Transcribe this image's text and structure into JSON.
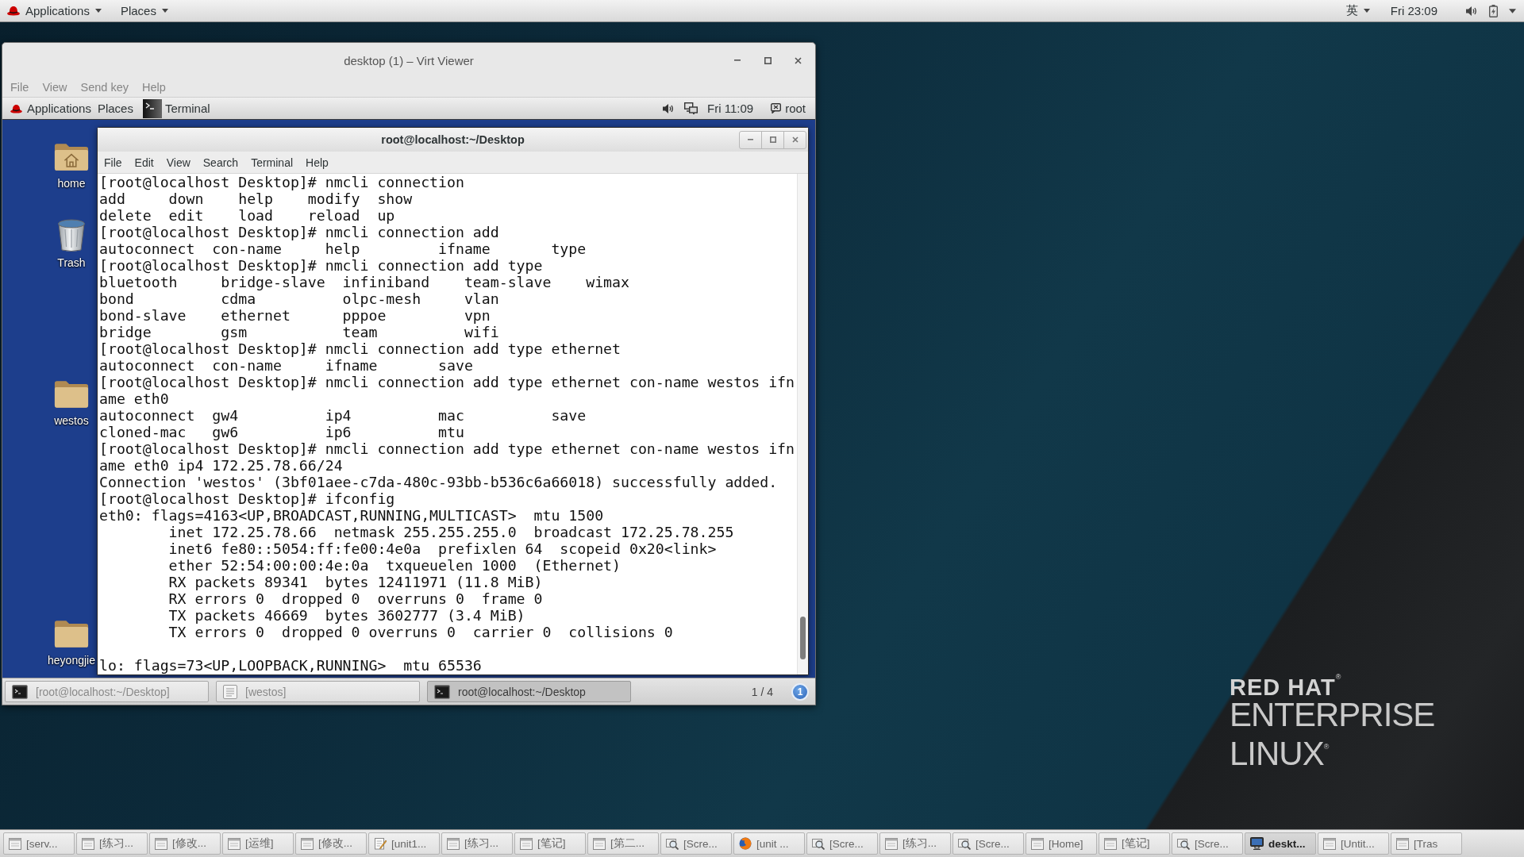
{
  "top_bar": {
    "applications": "Applications",
    "places": "Places",
    "input_method": "英",
    "clock": "Fri 23:09"
  },
  "virt_viewer": {
    "title": "desktop (1) – Virt Viewer",
    "menu": [
      "File",
      "View",
      "Send key",
      "Help"
    ],
    "guest": {
      "top_bar": {
        "applications": "Applications",
        "places": "Places",
        "active_app": "Terminal",
        "clock": "Fri 11:09",
        "user": "root"
      },
      "desktop_icons": [
        {
          "label": "home",
          "kind": "home"
        },
        {
          "label": "Trash",
          "kind": "trash"
        },
        {
          "label": "westos",
          "kind": "folder"
        },
        {
          "label": "heyongjie",
          "kind": "folder"
        }
      ],
      "terminal": {
        "title": "root@localhost:~/Desktop",
        "menu": [
          "File",
          "Edit",
          "View",
          "Search",
          "Terminal",
          "Help"
        ],
        "output_blocks": [
          [
            "[root@localhost Desktop]# nmcli connection",
            "add     down    help    modify  show",
            "delete  edit    load    reload  up",
            "[root@localhost Desktop]# nmcli connection add",
            "autoconnect  con-name     help         ifname       type",
            "[root@localhost Desktop]# nmcli connection add type",
            "bluetooth     bridge-slave  infiniband    team-slave    wimax",
            "bond          cdma          olpc-mesh     vlan",
            "bond-slave    ethernet      pppoe         vpn",
            "bridge        gsm           team          wifi",
            "[root@localhost Desktop]# nmcli connection add type ethernet",
            "autoconnect  con-name     ifname       save",
            "[root@localhost Desktop]# nmcli connection add type ethernet con-name westos ifn",
            "ame eth0",
            "autoconnect  gw4          ip4          mac          save",
            "cloned-mac   gw6          ip6          mtu",
            "[root@localhost Desktop]# nmcli connection add type ethernet con-name westos ifn",
            "ame eth0 ip4 172.25.78.66/24",
            "Connection 'westos' (3bf01aee-c7da-480c-93bb-b536c6a66018) successfully added.",
            "[root@localhost Desktop]# ifconfig",
            "eth0: flags=4163<UP,BROADCAST,RUNNING,MULTICAST>  mtu 1500",
            "        inet 172.25.78.66  netmask 255.255.255.0  broadcast 172.25.78.255",
            "        inet6 fe80::5054:ff:fe00:4e0a  prefixlen 64  scopeid 0x20<link>",
            "        ether 52:54:00:00:4e:0a  txqueuelen 1000  (Ethernet)",
            "        RX packets 89341  bytes 12411971 (11.8 MiB)",
            "        RX errors 0  dropped 0  overruns 0  frame 0",
            "        TX packets 46669  bytes 3602777 (3.4 MiB)",
            "        TX errors 0  dropped 0 overruns 0  carrier 0  collisions 0"
          ],
          [
            "lo: flags=73<UP,LOOPBACK,RUNNING>  mtu 65536"
          ]
        ]
      },
      "window_list": [
        {
          "label": "[root@localhost:~/Desktop]",
          "kind": "terminal",
          "selected": false
        },
        {
          "label": "[westos]",
          "kind": "document",
          "selected": false
        },
        {
          "label": "root@localhost:~/Desktop",
          "kind": "terminal",
          "selected": true
        }
      ],
      "workspace": "1 / 4",
      "notification_count": "1"
    }
  },
  "wallpaper_logo": {
    "line_1": "RED HAT$^{®}$",
    "line_2": "ENTERPRISE",
    "line_3": "LINUX$^{®}$"
  },
  "taskbar": [
    {
      "label": "[serv...",
      "kind": "window",
      "selected": false
    },
    {
      "label": "[练习...",
      "kind": "window",
      "selected": false
    },
    {
      "label": "[修改...",
      "kind": "window",
      "selected": false
    },
    {
      "label": "[运维]",
      "kind": "window",
      "selected": false
    },
    {
      "label": "[修改...",
      "kind": "window",
      "selected": false
    },
    {
      "label": "[unit1...",
      "kind": "editor",
      "selected": false
    },
    {
      "label": "[练习...",
      "kind": "window",
      "selected": false
    },
    {
      "label": "[笔记]",
      "kind": "window",
      "selected": false
    },
    {
      "label": "[第二...",
      "kind": "window",
      "selected": false
    },
    {
      "label": "[Scre...",
      "kind": "search",
      "selected": false
    },
    {
      "label": "[unit ...",
      "kind": "browser",
      "selected": false
    },
    {
      "label": "[Scre...",
      "kind": "search",
      "selected": false
    },
    {
      "label": "[练习...",
      "kind": "window",
      "selected": false
    },
    {
      "label": "[Scre...",
      "kind": "search",
      "selected": false
    },
    {
      "label": "[Home]",
      "kind": "window",
      "selected": false
    },
    {
      "label": "[笔记]",
      "kind": "window",
      "selected": false
    },
    {
      "label": "[Scre...",
      "kind": "search",
      "selected": false
    },
    {
      "label": "deskt...",
      "kind": "monitor",
      "selected": true
    },
    {
      "label": "[Untit...",
      "kind": "window",
      "selected": false
    },
    {
      "label": "[Tras",
      "kind": "window",
      "selected": false
    }
  ]
}
